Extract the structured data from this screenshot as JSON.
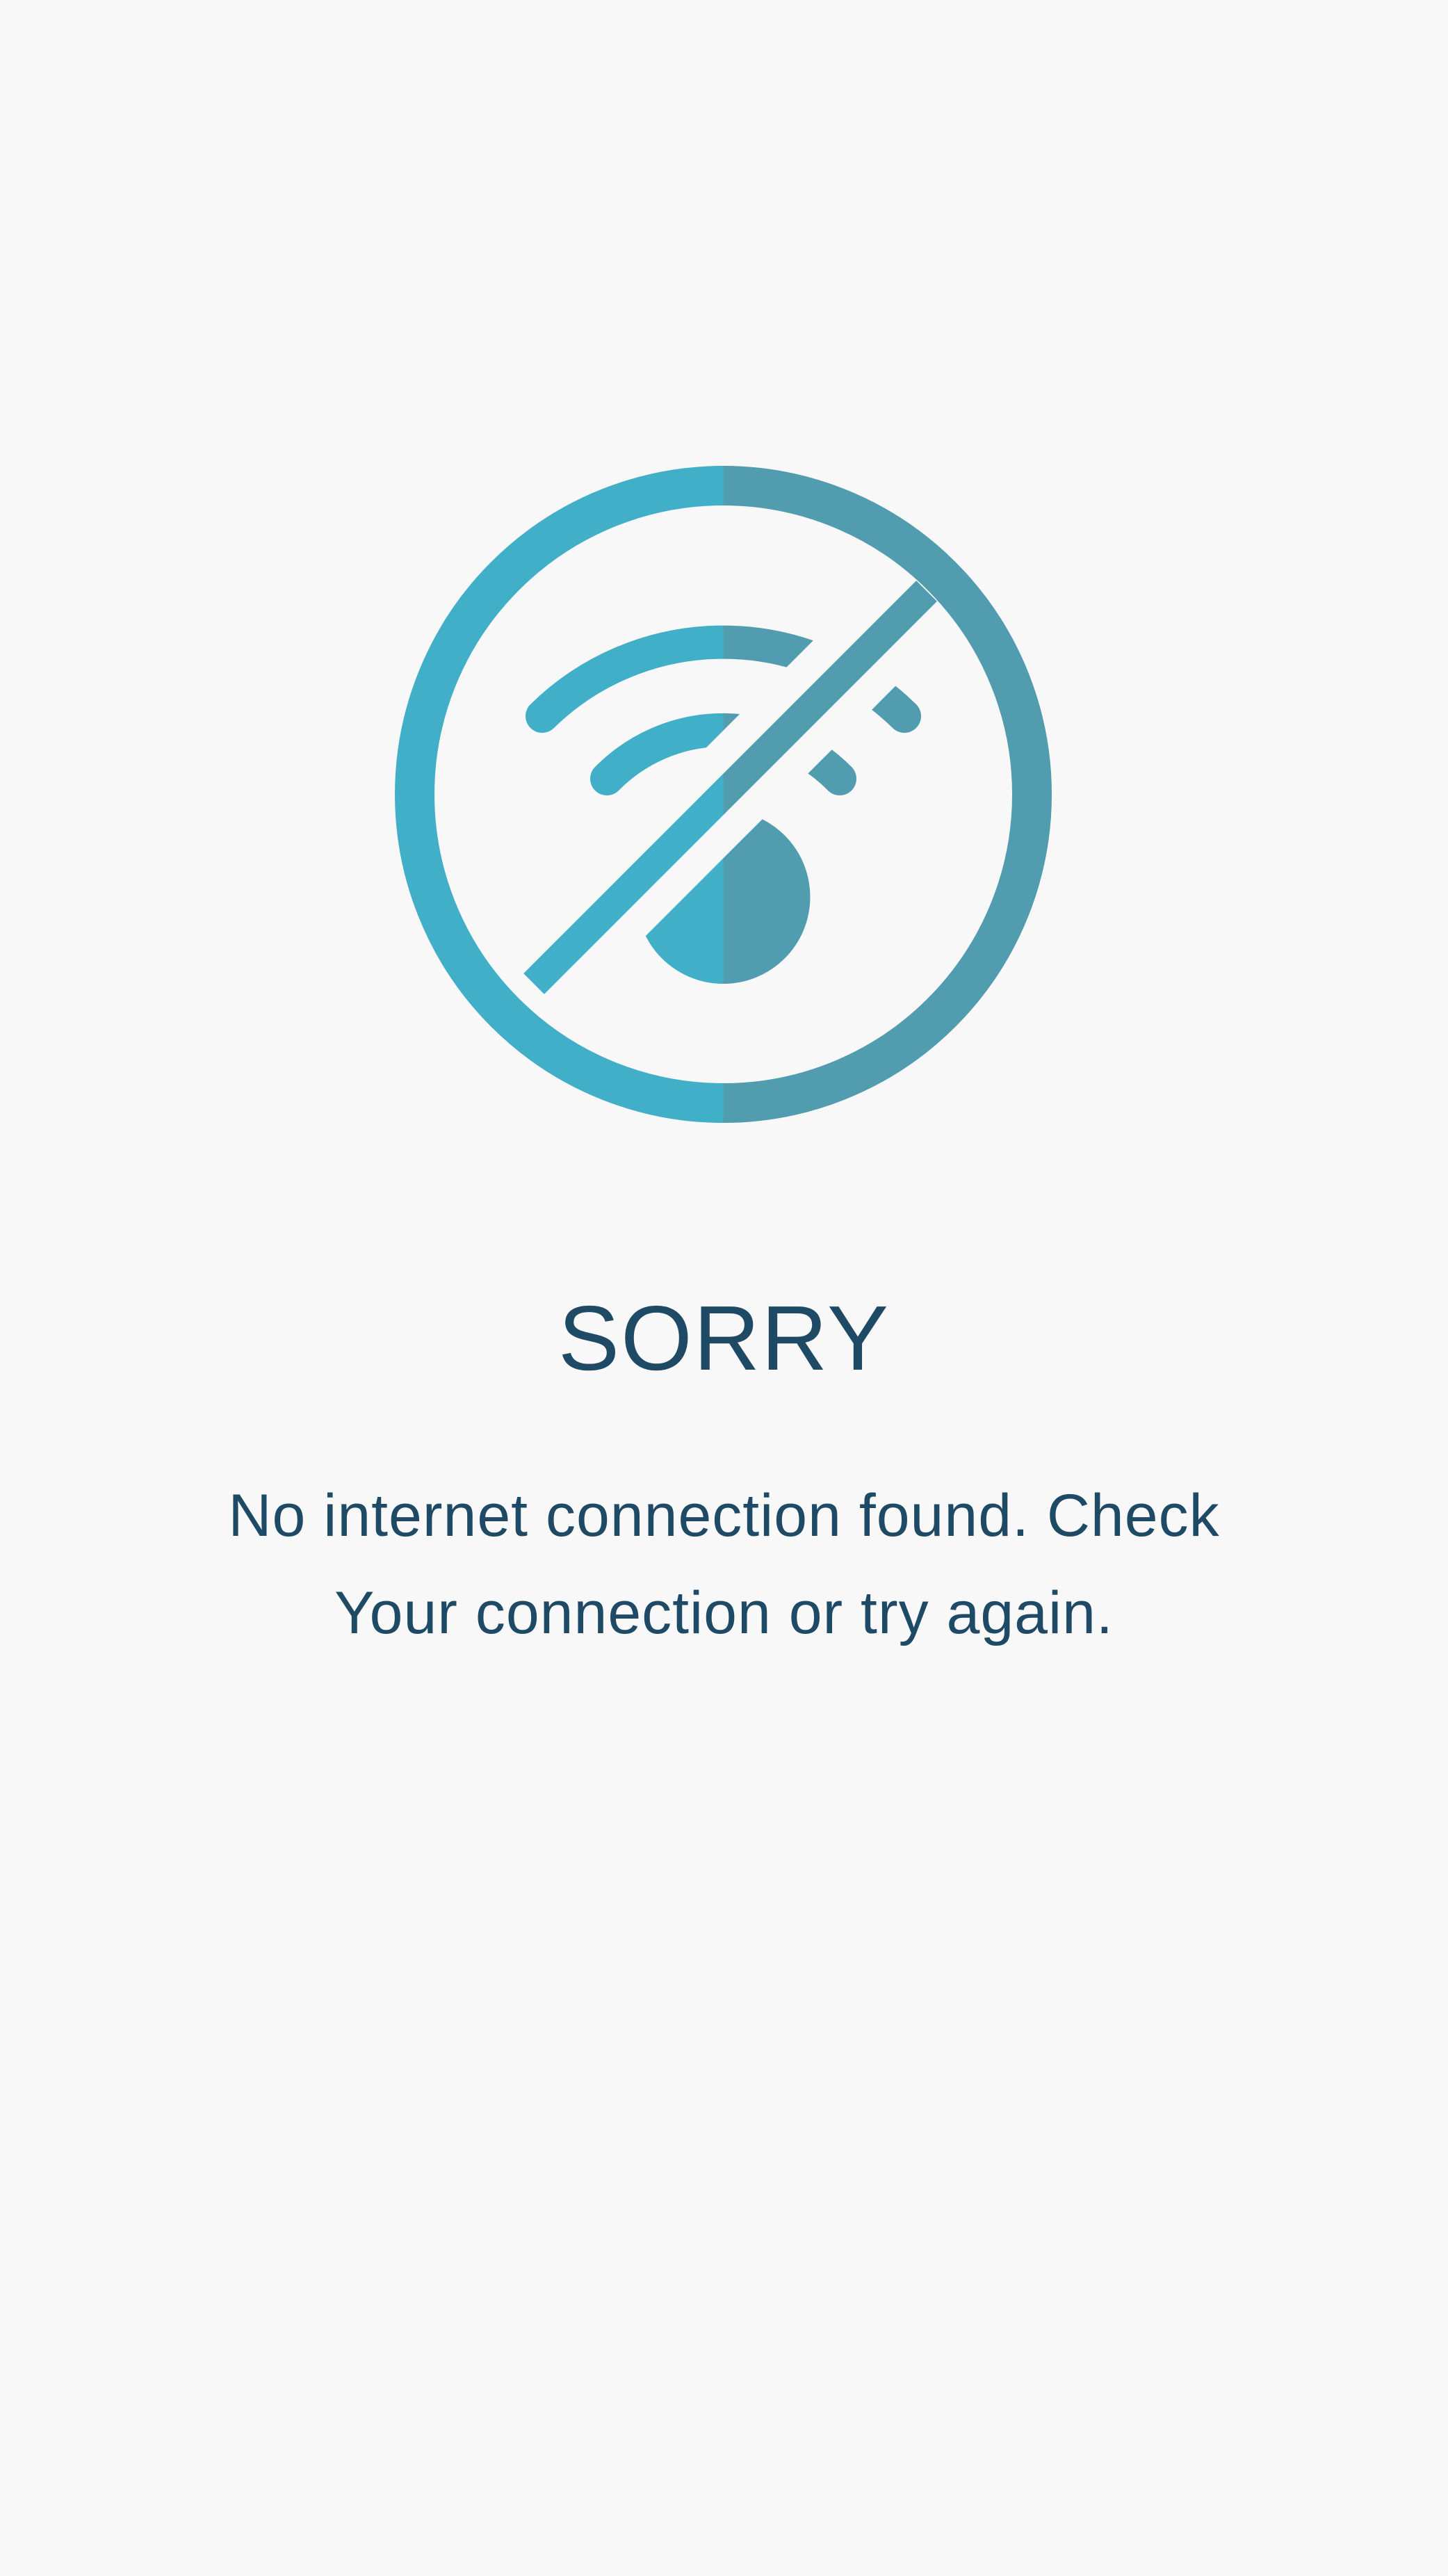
{
  "error_screen": {
    "icon": "wifi-off-icon",
    "title": "SORRY",
    "message_line1": "No internet connection found. Check",
    "message_line2": "Your connection or try again."
  },
  "colors": {
    "background": "#f8f8f9",
    "icon_light": "#42afc8",
    "icon_dark": "#529caf",
    "text": "#1f4a66"
  }
}
